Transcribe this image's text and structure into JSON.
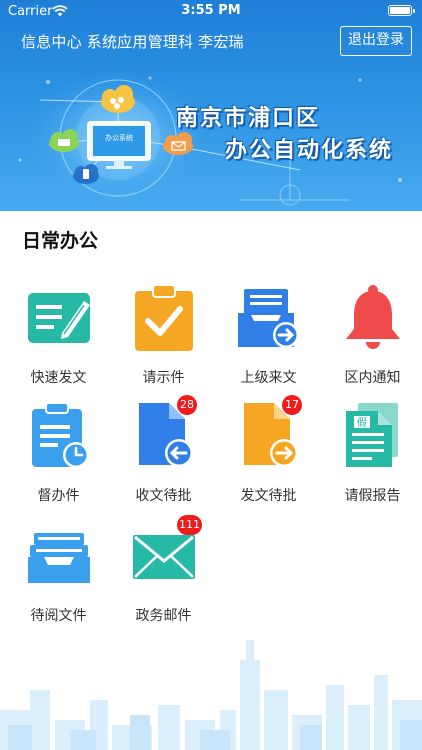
{
  "status_bar": {
    "carrier": "Carrier",
    "time": "3:55 PM"
  },
  "header": {
    "user_info": "信息中心 系统应用管理科 李宏瑞",
    "logout_label": "退出登录",
    "system_title_line1": "南京市浦口区",
    "system_title_line2": "办公自动化系统",
    "monitor_text": "办公系统"
  },
  "section": {
    "title": "日常办公"
  },
  "tiles": [
    {
      "label": "快速发文",
      "icon": "quick-document-icon",
      "badge": ""
    },
    {
      "label": "请示件",
      "icon": "clipboard-check-icon",
      "badge": ""
    },
    {
      "label": "上级来文",
      "icon": "inbox-arrow-icon",
      "badge": ""
    },
    {
      "label": "区内通知",
      "icon": "bell-icon",
      "badge": ""
    },
    {
      "label": "督办件",
      "icon": "clipboard-clock-icon",
      "badge": ""
    },
    {
      "label": "收文待批",
      "icon": "document-incoming-icon",
      "badge": "28"
    },
    {
      "label": "发文待批",
      "icon": "document-outgoing-icon",
      "badge": "17"
    },
    {
      "label": "请假报告",
      "icon": "leave-report-icon",
      "badge": ""
    },
    {
      "label": "待阅文件",
      "icon": "file-tray-icon",
      "badge": ""
    },
    {
      "label": "政务邮件",
      "icon": "mail-icon",
      "badge": "111"
    }
  ],
  "colors": {
    "teal": "#25b9a6",
    "orange": "#f5a623",
    "blue": "#2f7fe6",
    "red": "#f04b4b",
    "lightblue": "#3aa0ee",
    "badge": "#ee1c1c"
  }
}
